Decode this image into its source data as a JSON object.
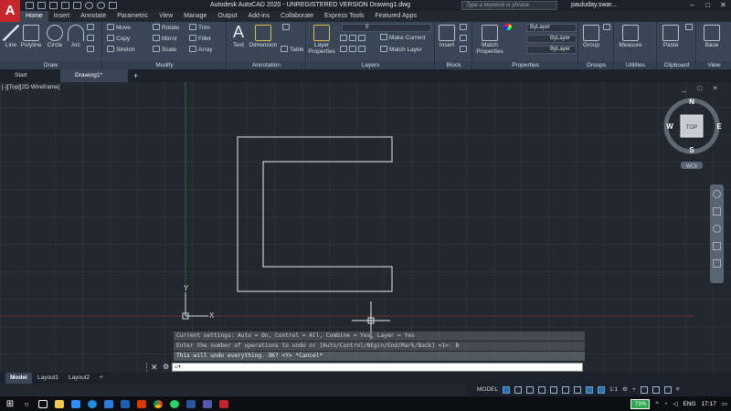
{
  "title_bar": {
    "title": "Autodesk AutoCAD 2020 - UNREGISTERED VERSION    Drawing1.dwg",
    "search_placeholder": "Type a keyword or phrase",
    "user": "pauluday.swar...",
    "logo": "A"
  },
  "ribbon_tabs": [
    {
      "label": "Home",
      "active": true
    },
    {
      "label": "Insert"
    },
    {
      "label": "Annotate"
    },
    {
      "label": "Parametric"
    },
    {
      "label": "View"
    },
    {
      "label": "Manage"
    },
    {
      "label": "Output"
    },
    {
      "label": "Add-ins"
    },
    {
      "label": "Collaborate"
    },
    {
      "label": "Express Tools"
    },
    {
      "label": "Featured Apps"
    }
  ],
  "panels": {
    "draw": {
      "title": "Draw",
      "tools": [
        "Line",
        "Polyline",
        "Circle",
        "Arc"
      ]
    },
    "modify": {
      "title": "Modify",
      "tools": [
        "Move",
        "Rotate",
        "Trim",
        "Copy",
        "Mirror",
        "Fillet",
        "Stretch",
        "Scale",
        "Array"
      ]
    },
    "annotation": {
      "title": "Annotation",
      "tools": [
        "Text",
        "Dimension",
        "Table"
      ]
    },
    "layers": {
      "title": "Layers",
      "tools": [
        "Layer Properties",
        "Make Current",
        "Match Layer"
      ],
      "layer_value": "0"
    },
    "block": {
      "title": "Block",
      "tools": [
        "Insert"
      ]
    },
    "properties": {
      "title": "Properties",
      "tools": [
        "Match Properties"
      ],
      "bylayer": [
        "ByLayer",
        "ByLayer",
        "ByLayer"
      ]
    },
    "groups": {
      "title": "Groups",
      "tools": [
        "Group"
      ]
    },
    "utilities": {
      "title": "Utilities",
      "tools": [
        "Measure"
      ]
    },
    "clipboard": {
      "title": "Clipboard",
      "tools": [
        "Paste"
      ]
    },
    "view": {
      "title": "View",
      "tools": [
        "Base"
      ]
    }
  },
  "file_tabs": [
    {
      "label": "Start"
    },
    {
      "label": "Drawing1*",
      "active": true
    }
  ],
  "viewport": {
    "label": "[-][Top][2D Wireframe]",
    "controls": "_ □ ×"
  },
  "navcube": {
    "top": "TOP",
    "n": "N",
    "s": "S",
    "e": "E",
    "w": "W",
    "wcs": "WCS"
  },
  "ucs": {
    "x": "X",
    "y": "Y"
  },
  "command_history": [
    "Current settings: Auto = On, Control = All, Combine = Yes, Layer = Yes",
    "Enter the number of operations to undo or [Auto/Control/BEgin/End/Mark/Back] <1>: B",
    "This will undo everything. OK? <Y> *Cancel*"
  ],
  "command_input": {
    "value": "",
    "prompt": "▭▾"
  },
  "layout_tabs": [
    {
      "label": "Model",
      "active": true
    },
    {
      "label": "Layout1"
    },
    {
      "label": "Layout2"
    },
    {
      "label": "+"
    }
  ],
  "status": {
    "mode": "MODEL",
    "scale": "1:1"
  },
  "taskbar": {
    "battery": "73%",
    "lang": "ENG",
    "time": "17:17"
  },
  "colors": {
    "canvas": "#212830",
    "ribbon": "#3a4656",
    "accent": "#c4262e"
  }
}
